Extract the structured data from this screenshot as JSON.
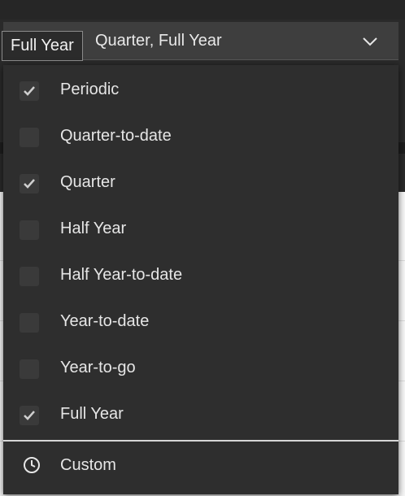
{
  "select": {
    "value": "Quarter, Full Year",
    "icon": "chevron-down-icon"
  },
  "tooltip": {
    "text": "Full Year"
  },
  "options": [
    {
      "label": "Periodic",
      "checked": true
    },
    {
      "label": "Quarter-to-date",
      "checked": false
    },
    {
      "label": "Quarter",
      "checked": true
    },
    {
      "label": "Half Year",
      "checked": false
    },
    {
      "label": "Half Year-to-date",
      "checked": false
    },
    {
      "label": "Year-to-date",
      "checked": false
    },
    {
      "label": "Year-to-go",
      "checked": false
    },
    {
      "label": "Full Year",
      "checked": true
    }
  ],
  "custom": {
    "label": "Custom",
    "icon": "clock-icon"
  },
  "colors": {
    "accent_red": "#c8102e",
    "panel_bg": "#2e2e2e",
    "check_mark": "#cfcfcf"
  }
}
